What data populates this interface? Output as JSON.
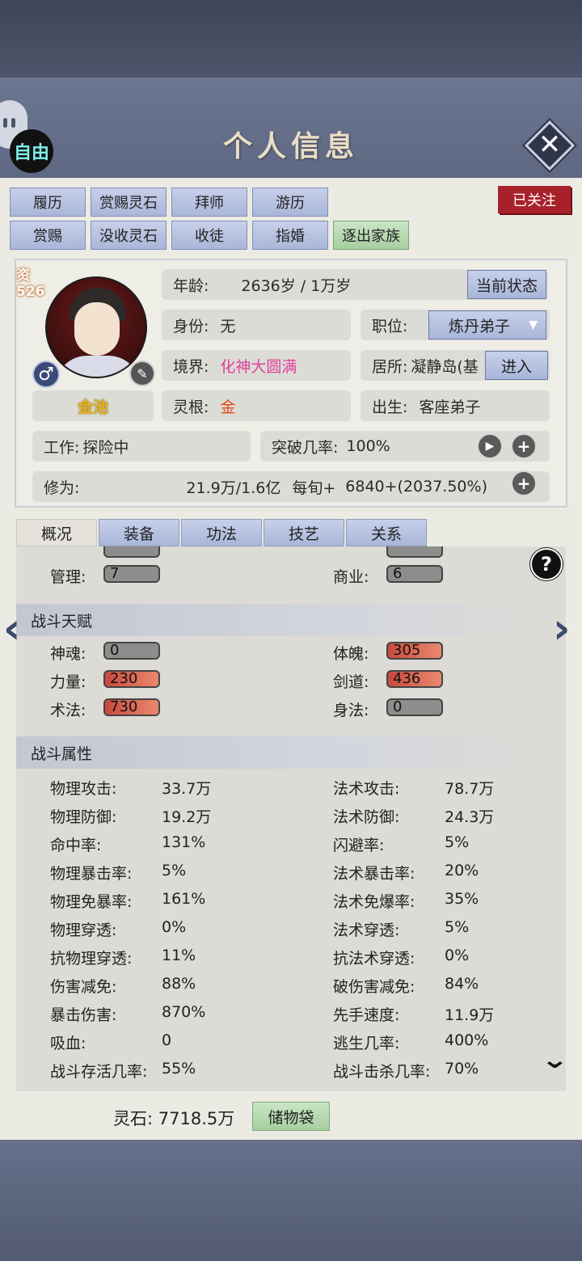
{
  "title": "个人信息",
  "free_badge": "自由",
  "followed": "已关注",
  "actions": {
    "row1": [
      "履历",
      "赏赐灵石",
      "拜师",
      "游历"
    ],
    "row2": [
      "赏赐",
      "没收灵石",
      "收徒",
      "指婚",
      "逐出家族"
    ]
  },
  "aptitude": {
    "label": "资",
    "value": "526"
  },
  "root_name": "金池",
  "info": {
    "age_label": "年龄:",
    "age_value": "2636岁 / 1万岁",
    "status_button": "当前状态",
    "identity_label": "身份:",
    "identity_value": "无",
    "position_label": "职位:",
    "position_value": "炼丹弟子",
    "realm_label": "境界:",
    "realm_value": "化神大圆满",
    "residence_label": "居所:",
    "residence_value": "凝静岛(基",
    "enter_button": "进入",
    "root_label": "灵根:",
    "root_value": "金",
    "birth_label": "出生:",
    "birth_value": "客座弟子",
    "work_label": "工作:",
    "work_value": "探险中",
    "breakthrough_label": "突破几率:",
    "breakthrough_value": "100%",
    "cultivation_label": "修为:",
    "cultivation_value": "21.9万/1.6亿",
    "per_round_label": "每旬+",
    "per_round_value": "6840+(2037.50%)"
  },
  "tabs": [
    "概况",
    "装备",
    "功法",
    "技艺",
    "关系"
  ],
  "management": [
    {
      "label": "管理:",
      "value": "7"
    },
    {
      "label": "商业:",
      "value": "6"
    }
  ],
  "combat_talent": {
    "title": "战斗天赋",
    "items": [
      {
        "label": "神魂:",
        "value": "0"
      },
      {
        "label": "体魄:",
        "value": "305"
      },
      {
        "label": "力量:",
        "value": "230"
      },
      {
        "label": "剑道:",
        "value": "436"
      },
      {
        "label": "术法:",
        "value": "730"
      },
      {
        "label": "身法:",
        "value": "0"
      }
    ]
  },
  "combat_attr": {
    "title": "战斗属性",
    "items": [
      {
        "label": "物理攻击:",
        "value": "33.7万"
      },
      {
        "label": "法术攻击:",
        "value": "78.7万"
      },
      {
        "label": "物理防御:",
        "value": "19.2万"
      },
      {
        "label": "法术防御:",
        "value": "24.3万"
      },
      {
        "label": "命中率:",
        "value": "131%"
      },
      {
        "label": "闪避率:",
        "value": "5%"
      },
      {
        "label": "物理暴击率:",
        "value": "5%"
      },
      {
        "label": "法术暴击率:",
        "value": "20%"
      },
      {
        "label": "物理免暴率:",
        "value": "161%"
      },
      {
        "label": "法术免爆率:",
        "value": "35%"
      },
      {
        "label": "物理穿透:",
        "value": "0%"
      },
      {
        "label": "法术穿透:",
        "value": "5%"
      },
      {
        "label": "抗物理穿透:",
        "value": "11%"
      },
      {
        "label": "抗法术穿透:",
        "value": "0%"
      },
      {
        "label": "伤害减免:",
        "value": "88%"
      },
      {
        "label": "破伤害减免:",
        "value": "84%"
      },
      {
        "label": "暴击伤害:",
        "value": "870%"
      },
      {
        "label": "先手速度:",
        "value": "11.9万"
      },
      {
        "label": "吸血:",
        "value": "0"
      },
      {
        "label": "逃生几率:",
        "value": "400%"
      },
      {
        "label": "战斗存活几率:",
        "value": "55%"
      },
      {
        "label": "战斗击杀几率:",
        "value": "70%"
      }
    ]
  },
  "footer": {
    "spirit_stone": "灵石: 7718.5万",
    "storage_button": "储物袋"
  }
}
